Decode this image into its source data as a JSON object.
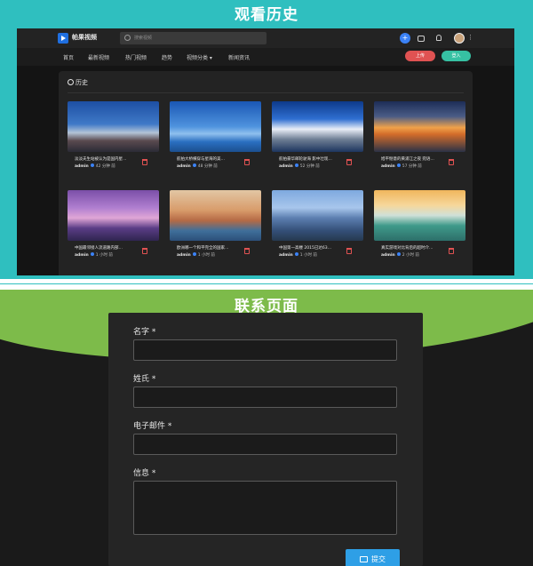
{
  "history_section": {
    "banner_title": "观看历史",
    "app": {
      "logo_text": "帕果视频",
      "search_placeholder": "搜索视频",
      "nav": [
        "首页",
        "最新视频",
        "热门视频",
        "趋势",
        "视频分类 ▾",
        "新闻资讯"
      ],
      "upload_label": "上传",
      "login_label": "登入"
    },
    "panel_title": "历史",
    "videos": [
      {
        "title": "淡淡夫生站被认为是国内星…",
        "author": "admin",
        "time": "42 分钟 前",
        "thumb_icon": "railway-station"
      },
      {
        "title": "航拍大桥横穿与星海的美…",
        "author": "admin",
        "time": "48 分钟 前",
        "thumb_icon": "bridge"
      },
      {
        "title": "航拍豪华邮轮驶海 影中壮现…",
        "author": "admin",
        "time": "52 分钟 前",
        "thumb_icon": "cruise-ship"
      },
      {
        "title": "旭平惬意的黄浦江之夜 宛语…",
        "author": "admin",
        "time": "57 分钟 前",
        "thumb_icon": "sunset"
      },
      {
        "title": "中国最邻接人流道路内部…",
        "author": "admin",
        "time": "1 小时 前",
        "thumb_icon": "city-skyline"
      },
      {
        "title": "欧洲哪一个和平完全的国家…",
        "author": "admin",
        "time": "1 小时 前",
        "thumb_icon": "old-town"
      },
      {
        "title": "中国第一高楼 2015已达63…",
        "author": "admin",
        "time": "1 小时 前",
        "thumb_icon": "skyscraper"
      },
      {
        "title": "真实游戏对比背后的超时介…",
        "author": "admin",
        "time": "2 小时 前",
        "thumb_icon": "seaside"
      }
    ]
  },
  "contact_section": {
    "banner_title": "联系页面",
    "fields": {
      "name_label": "名字 *",
      "surname_label": "姓氏 *",
      "email_label": "电子邮件 *",
      "message_label": "信息 *"
    },
    "submit_label": "提交"
  }
}
